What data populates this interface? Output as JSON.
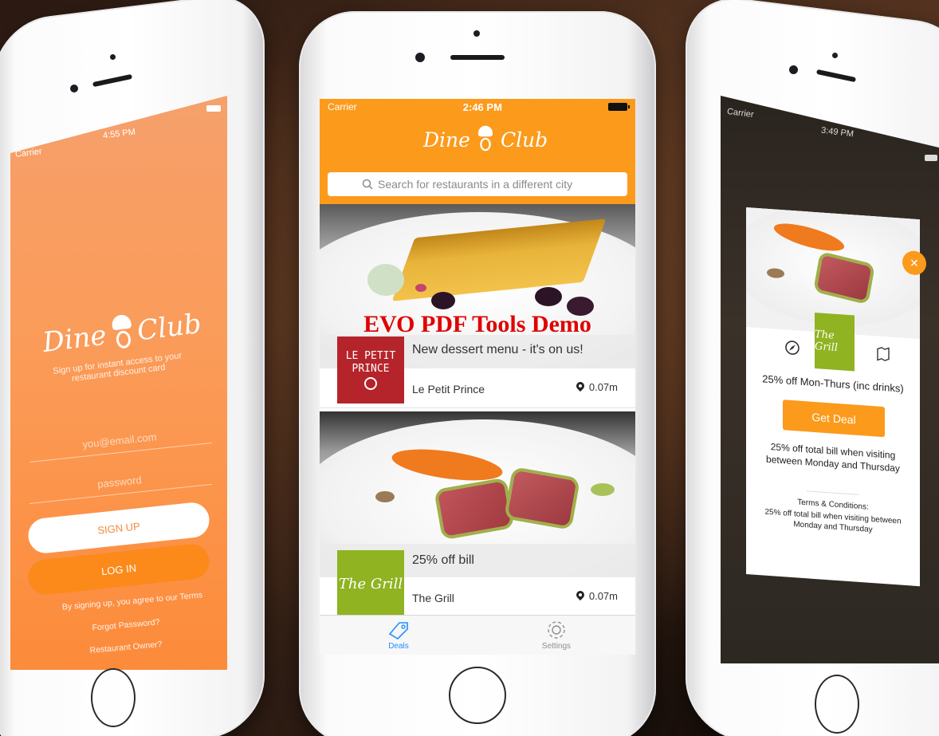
{
  "login_screen": {
    "carrier": "Carrier",
    "time": "4:55 PM",
    "brand_left": "Dine",
    "brand_right": "Club",
    "tagline": "Sign up for instant access to your restaurant discount card",
    "email_placeholder": "you@email.com",
    "password_placeholder": "password",
    "signup_label": "SIGN UP",
    "login_label": "LOG IN",
    "terms_text": "By signing up, you agree to our Terms",
    "forgot_password": "Forgot Password?",
    "restaurant_owner": "Restaurant Owner?"
  },
  "deals_screen": {
    "carrier": "Carrier",
    "time": "2:46 PM",
    "brand_left": "Dine",
    "brand_right": "Club",
    "search_placeholder": "Search for restaurants in a different city",
    "watermark": "EVO PDF Tools Demo",
    "deals": [
      {
        "title": "New dessert menu - it's on us!",
        "restaurant": "Le Petit Prince",
        "distance": "0.07m",
        "logo_line1": "LE PETIT",
        "logo_line2": "PRINCE"
      },
      {
        "title": "25% off bill",
        "restaurant": "The Grill",
        "distance": "0.07m",
        "logo_text": "The Grill"
      }
    ],
    "tabs": [
      {
        "label": "Deals",
        "icon": "tag-icon",
        "active": true
      },
      {
        "label": "Settings",
        "icon": "gear-icon",
        "active": false
      }
    ]
  },
  "deal_detail_screen": {
    "carrier": "Carrier",
    "time": "3:49 PM",
    "close_icon": "close-icon",
    "logo_text": "The Grill",
    "offer": "25% off Mon-Thurs (inc drinks)",
    "get_deal_label": "Get Deal",
    "description": "25% off total bill when visiting between Monday and Thursday",
    "terms_heading": "Terms & Conditions:",
    "terms_body": "25% off total bill when visiting between Monday and Thursday"
  },
  "colors": {
    "accent_orange": "#fc9a1b",
    "login_gradient_top": "#f6a06b",
    "login_gradient_bottom": "#fc8b3a",
    "petit_prince_red": "#b5242a",
    "grill_green": "#8fb321",
    "tab_active_blue": "#1e90ff"
  }
}
